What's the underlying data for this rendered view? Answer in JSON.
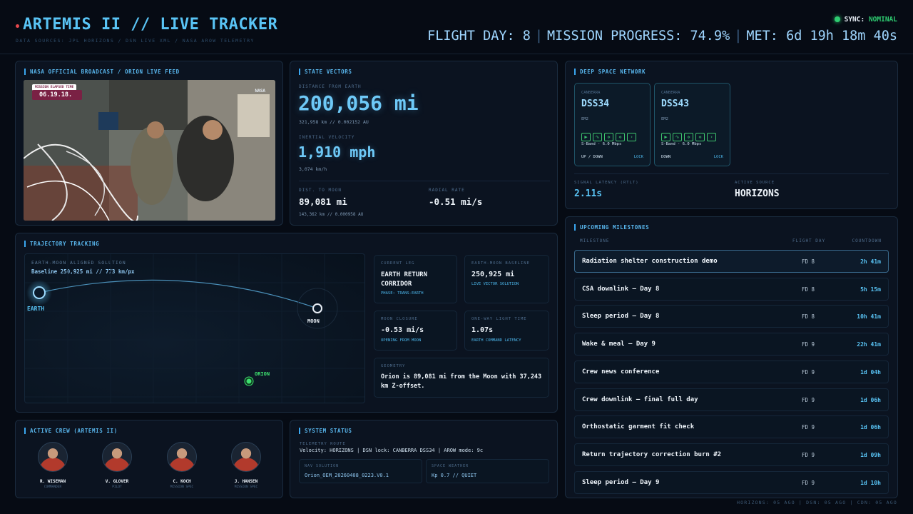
{
  "header": {
    "title": "ARTEMIS II // LIVE TRACKER",
    "subtitle": "DATA SOURCES: JPL HORIZONS / DSN LIVE XML / NASA AROW TELEMETRY",
    "sync_label": "SYNC:",
    "sync_value": "NOMINAL",
    "flight_day": "FLIGHT DAY: 8",
    "mission_progress": "MISSION PROGRESS: 74.9%",
    "met": "MET: 6d 19h 18m 40s",
    "separator": "|"
  },
  "broadcast": {
    "title": "NASA OFFICIAL BROADCAST / ORION LIVE FEED",
    "overlay_tag": "MISSION ELAPSED TIME",
    "overlay_time": "06.19.18.",
    "overlay_logo": "NASA"
  },
  "state_vectors": {
    "title": "STATE VECTORS",
    "distance_label": "DISTANCE FROM EARTH",
    "distance_value": "200,056 mi",
    "distance_sub": "321,958 km // 0.002152 AU",
    "velocity_label": "INERTIAL VELOCITY",
    "velocity_value": "1,910 mph",
    "velocity_sub": "3,074 km/h",
    "moon_label": "DIST. TO MOON",
    "moon_value": "89,081 mi",
    "moon_sub": "143,362 km // 0.000958 AU",
    "radial_label": "RADIAL RATE",
    "radial_value": "-0.51 mi/s"
  },
  "dsn": {
    "title": "DEEP SPACE NETWORK",
    "stations": [
      {
        "site": "CANBERRA",
        "name": "DSS34",
        "code": "EM2",
        "band": "S-Band · 6.0 Mbps",
        "dir": "UP / DOWN",
        "lock": "LOCK"
      },
      {
        "site": "CANBERRA",
        "name": "DSS43",
        "code": "EM2",
        "band": "S-Band · 6.0 Mbps",
        "dir": "DOWN",
        "lock": "LOCK"
      }
    ],
    "latency_label": "SIGNAL LATENCY (RTLT)",
    "latency_value": "2.11s",
    "source_label": "ACTIVE SOURCE",
    "source_value": "HORIZONS"
  },
  "milestones": {
    "title": "UPCOMING MILESTONES",
    "col_milestone": "MILESTONE",
    "col_fd": "FLIGHT DAY",
    "col_countdown": "COUNTDOWN",
    "rows": [
      {
        "name": "Radiation shelter construction demo",
        "fd": "FD 8",
        "cd": "2h 41m"
      },
      {
        "name": "CSA downlink — Day 8",
        "fd": "FD 8",
        "cd": "5h 15m"
      },
      {
        "name": "Sleep period — Day 8",
        "fd": "FD 8",
        "cd": "10h 41m"
      },
      {
        "name": "Wake & meal — Day 9",
        "fd": "FD 9",
        "cd": "22h 41m"
      },
      {
        "name": "Crew news conference",
        "fd": "FD 9",
        "cd": "1d 04h"
      },
      {
        "name": "Crew downlink — final full day",
        "fd": "FD 9",
        "cd": "1d 06h"
      },
      {
        "name": "Orthostatic garment fit check",
        "fd": "FD 9",
        "cd": "1d 06h"
      },
      {
        "name": "Return trajectory correction burn #2",
        "fd": "FD 9",
        "cd": "1d 09h"
      },
      {
        "name": "Sleep period — Day 9",
        "fd": "FD 9",
        "cd": "1d 10h"
      }
    ]
  },
  "trajectory": {
    "title": "TRAJECTORY TRACKING",
    "map_label": "EARTH-MOON ALIGNED SOLUTION",
    "baseline_text": "Baseline 250,925 mi // 773 km/px",
    "earth_label": "EARTH",
    "moon_label": "MOON",
    "orion_label": "ORION",
    "leg_label": "CURRENT LEG",
    "leg_value": "EARTH RETURN CORRIDOR",
    "leg_sub": "PHASE: TRANS-EARTH",
    "baseline_label": "EARTH-MOON BASELINE",
    "baseline_value": "250,925 mi",
    "baseline_sub": "LIVE VECTOR SOLUTION",
    "closure_label": "MOON CLOSURE",
    "closure_value": "-0.53 mi/s",
    "closure_sub": "OPENING FROM MOON",
    "light_label": "ONE-WAY LIGHT TIME",
    "light_value": "1.07s",
    "light_sub": "EARTH COMMAND LATENCY",
    "geometry_label": "GEOMETRY",
    "geometry_value": "Orion is 89,081 mi from the Moon with 37,243 km Z-offset."
  },
  "crew": {
    "title": "ACTIVE CREW (ARTEMIS II)",
    "members": [
      {
        "name": "R. WISEMAN",
        "role": "COMMANDER"
      },
      {
        "name": "V. GLOVER",
        "role": "PILOT"
      },
      {
        "name": "C. KOCH",
        "role": "MISSION SPEC"
      },
      {
        "name": "J. HANSEN",
        "role": "MISSION SPEC"
      }
    ]
  },
  "system": {
    "title": "SYSTEM STATUS",
    "route_label": "TELEMETRY ROUTE",
    "route_value": "Velocity: HORIZONS | DSN lock: CANBERRA DSS34 | AROW mode: 9c",
    "nav_label": "NAV SOLUTION",
    "nav_value": "Orion_OEM_20260408_0223.V0.1",
    "weather_label": "SPACE WEATHER",
    "weather_value": "Kp 0.7 // QUIET"
  },
  "footer": "HORIZONS: 05 AGO | DSN: 05 AGO | CDN: 05 AGO",
  "colors": {
    "accent": "#59c4f5",
    "nominal": "#2ecc71",
    "background": "#060b14",
    "orion": "#3ee06f"
  }
}
